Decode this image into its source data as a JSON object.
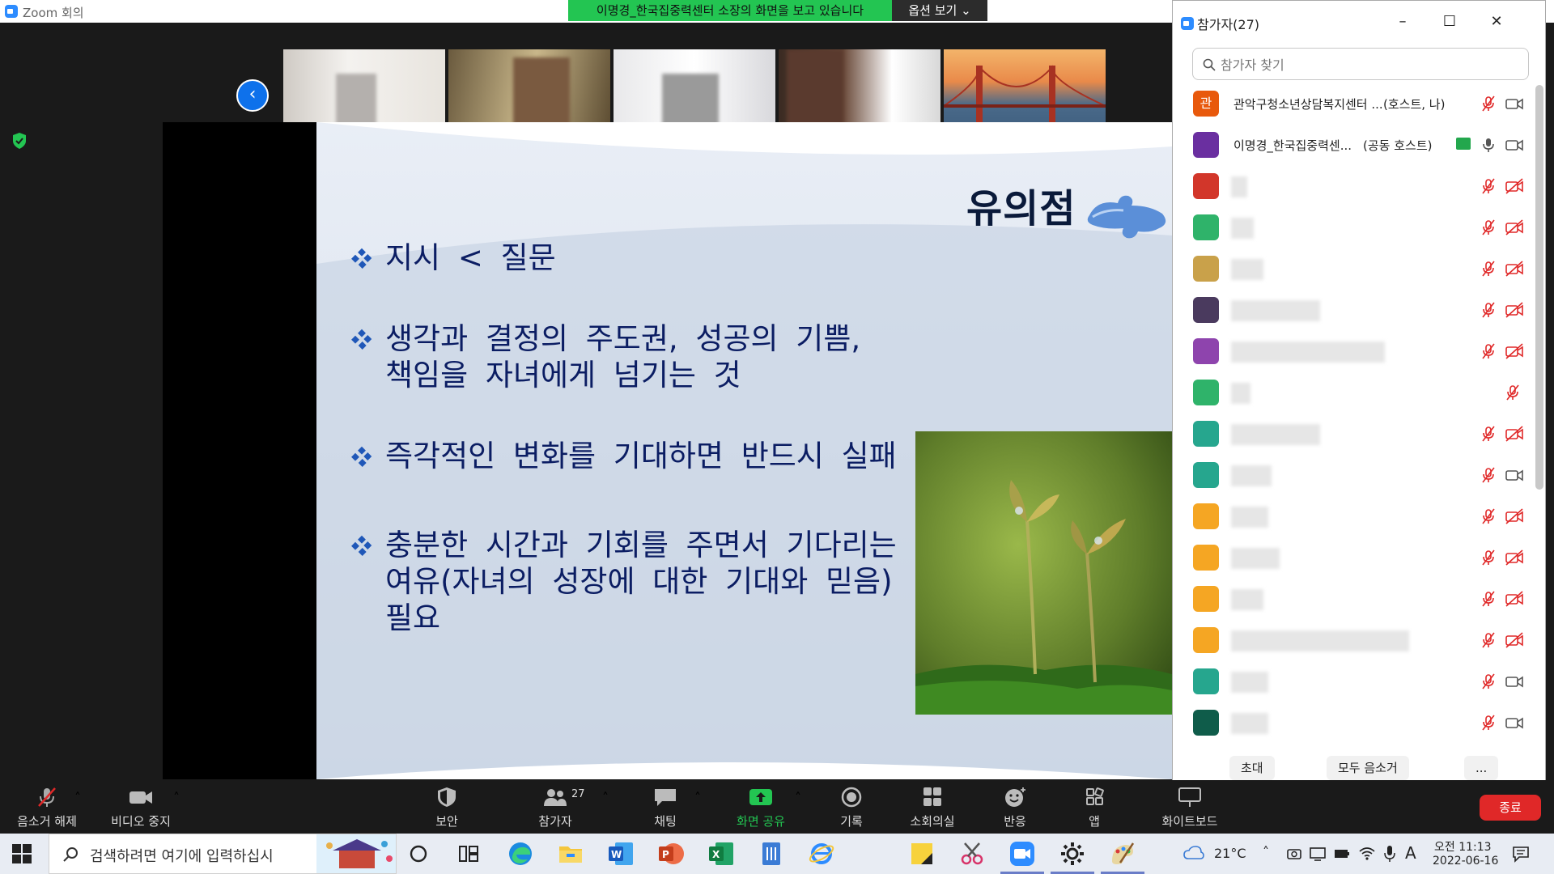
{
  "window": {
    "title": "Zoom 회의"
  },
  "share_banner": {
    "text": "이명경_한국집중력센터 소장의 화면을 보고 있습니다",
    "options_label": "옵션 보기"
  },
  "strip": {
    "more_label": "c"
  },
  "slide": {
    "title": "유의점",
    "bullets": [
      "지시 < 질문",
      "생각과 결정의 주도권, 성공의 기쁨,\n책임을 자녀에게 넘기는 것",
      "즉각적인 변화를 기대하면 반드시 실패",
      "충분한 시간과 기회를 주면서 기다리는\n여유(자녀의 성장에 대한 기대와 믿음)\n필요"
    ]
  },
  "participants_panel": {
    "title": "참가자(27)",
    "search_placeholder": "참가자 찾기",
    "rows": [
      {
        "avatar_text": "관",
        "avatar_color": "#e8590c",
        "name": "관악구청소년상담복지센터 ...",
        "role": "(호스트, 나)",
        "mic": "muted",
        "video": "on"
      },
      {
        "avatar_text": "",
        "avatar_color": "#6a2fa0",
        "name": "이명경_한국집중력센...",
        "role": "(공동 호스트)",
        "mic": "on",
        "video": "on",
        "sharing": true
      },
      {
        "avatar_text": "",
        "avatar_color": "#d2362a",
        "name": "",
        "mic": "muted",
        "video": "off"
      },
      {
        "avatar_text": "",
        "avatar_color": "#2fb36a",
        "name": "",
        "mic": "muted",
        "video": "off"
      },
      {
        "avatar_text": "",
        "avatar_color": "#c9a14a",
        "name": "",
        "mic": "muted",
        "video": "off"
      },
      {
        "avatar_text": "",
        "avatar_color": "#4a3a5e",
        "name": "",
        "mic": "muted",
        "video": "off"
      },
      {
        "avatar_text": "",
        "avatar_color": "#8e44ad",
        "name": "",
        "mic": "muted",
        "video": "off"
      },
      {
        "avatar_text": "",
        "avatar_color": "#2fb36a",
        "name": "",
        "mic": "muted",
        "video": "none"
      },
      {
        "avatar_text": "",
        "avatar_color": "#26a68e",
        "name": "",
        "mic": "muted",
        "video": "off"
      },
      {
        "avatar_text": "",
        "avatar_color": "#26a68e",
        "name": "",
        "mic": "muted",
        "video": "on"
      },
      {
        "avatar_text": "",
        "avatar_color": "#f5a623",
        "name": "",
        "mic": "muted",
        "video": "off"
      },
      {
        "avatar_text": "",
        "avatar_color": "#f5a623",
        "name": "",
        "mic": "muted",
        "video": "off"
      },
      {
        "avatar_text": "",
        "avatar_color": "#f5a623",
        "name": "",
        "mic": "muted",
        "video": "off"
      },
      {
        "avatar_text": "",
        "avatar_color": "#f5a623",
        "name": "",
        "mic": "muted",
        "video": "off"
      },
      {
        "avatar_text": "",
        "avatar_color": "#26a68e",
        "name": "",
        "mic": "muted",
        "video": "on"
      },
      {
        "avatar_text": "",
        "avatar_color": "#0f5c4a",
        "name": "",
        "mic": "muted",
        "video": "on"
      }
    ],
    "footer": {
      "invite": "초대",
      "mute_all": "모두 음소거",
      "more": "..."
    }
  },
  "toolbar": {
    "unmute": "음소거 해제",
    "stop_video": "비디오 중지",
    "security": "보안",
    "participants": "참가자",
    "participants_count": "27",
    "chat": "채팅",
    "share_screen": "화면 공유",
    "record": "기록",
    "breakout": "소회의실",
    "reactions": "반응",
    "apps": "앱",
    "whiteboard": "화이트보드",
    "end": "종료"
  },
  "taskbar": {
    "search_text": "검색하려면 여기에 입력하십시",
    "temperature": "21°C",
    "ime": "A",
    "time": "오전 11:13",
    "date": "2022-06-16"
  },
  "colors": {
    "accent": "#2d8cff",
    "share_green": "#23c552",
    "end_red": "#e02828",
    "muted_red": "#e02828"
  }
}
